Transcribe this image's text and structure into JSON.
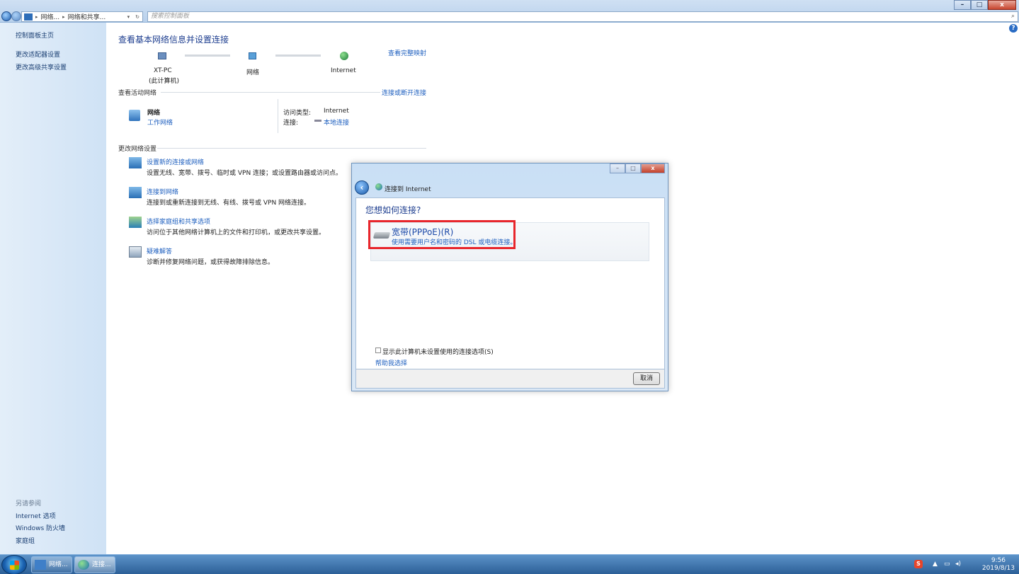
{
  "window": {
    "breadcrumb": [
      "网络...",
      "网络和共享..."
    ],
    "search_placeholder": "搜索控制面板",
    "buttons": {
      "minimize": "–",
      "maximize": "□",
      "close": "x"
    }
  },
  "sidebar": {
    "items": [
      "控制面板主页",
      "更改适配器设置",
      "更改高级共享设置"
    ],
    "see_also_heading": "另请参阅",
    "see_also": [
      "Internet 选项",
      "Windows 防火墙",
      "家庭组"
    ]
  },
  "main": {
    "title": "查看基本网络信息并设置连接",
    "view_full_map": "查看完整映射",
    "map": {
      "computer": "XT-PC",
      "computer_sub": "(此计算机)",
      "network": "网络",
      "internet": "Internet"
    },
    "active_networks_heading": "查看活动网络",
    "connect_disconnect": "连接或断开连接",
    "active_network": {
      "name": "网络",
      "type": "工作网络",
      "access_type_label": "访问类型:",
      "access_type_value": "Internet",
      "connection_label": "连接:",
      "connection_value": "本地连接"
    },
    "change_settings_heading": "更改网络设置",
    "tasks": [
      {
        "title": "设置新的连接或网络",
        "desc": "设置无线、宽带、拨号、临时或 VPN 连接；或设置路由器或访问点。"
      },
      {
        "title": "连接到网络",
        "desc": "连接到或重新连接到无线、有线、拨号或 VPN 网络连接。"
      },
      {
        "title": "选择家庭组和共享选项",
        "desc": "访问位于其他网络计算机上的文件和打印机，或更改共享设置。"
      },
      {
        "title": "疑难解答",
        "desc": "诊断并修复网络问题，或获得故障排除信息。"
      }
    ]
  },
  "dialog": {
    "title": "连接到 Internet",
    "question": "您想如何连接?",
    "option_title": "宽带(PPPoE)(R)",
    "option_desc": "使用需要用户名和密码的 DSL 或电缆连接。",
    "show_unconfigured": "显示此计算机未设置使用的连接选项(S)",
    "help_choose": "帮助我选择",
    "cancel": "取消"
  },
  "taskbar": {
    "items": [
      "网络...",
      "连接..."
    ],
    "time": "9:56",
    "date": "2019/8/13"
  },
  "colors": {
    "highlight_box": "#e8262c",
    "link": "#1e5fbf",
    "heading": "#1c3d8f"
  }
}
